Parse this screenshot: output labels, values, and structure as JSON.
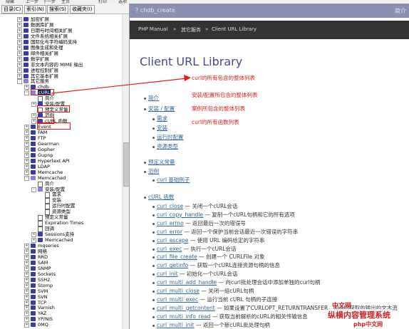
{
  "menubar": [
    "隐藏",
    "上一步",
    "下一步",
    "主页",
    "打印",
    "选项"
  ],
  "left": {
    "tabs": [
      "目录(C)",
      "索引(N)",
      "搜索(S)",
      "收藏夹(I)"
    ],
    "tree": [
      {
        "d": 1,
        "e": "+",
        "i": "book",
        "t": "加密扩展"
      },
      {
        "d": 1,
        "e": "+",
        "i": "book",
        "t": "数据库扩展"
      },
      {
        "d": 1,
        "e": "+",
        "i": "book",
        "t": "日期与时间相关扩展"
      },
      {
        "d": 1,
        "e": "+",
        "i": "book",
        "t": "文件系统相关扩展"
      },
      {
        "d": 1,
        "e": "+",
        "i": "book",
        "t": "国际化与字符编码支持"
      },
      {
        "d": 1,
        "e": "+",
        "i": "book",
        "t": "图像生成和处理"
      },
      {
        "d": 1,
        "e": "+",
        "i": "book",
        "t": "邮件相关扩展"
      },
      {
        "d": 1,
        "e": "+",
        "i": "book",
        "t": "数学扩展"
      },
      {
        "d": 1,
        "e": "+",
        "i": "book",
        "t": "非文本内容的 MIME 输出"
      },
      {
        "d": 1,
        "e": "+",
        "i": "book",
        "t": "进程控制扩展"
      },
      {
        "d": 1,
        "e": "+",
        "i": "book",
        "t": "其它基本扩展"
      },
      {
        "d": 1,
        "e": "-",
        "i": "open",
        "t": "其它服务"
      },
      {
        "d": 2,
        "e": "+",
        "i": "book",
        "t": "chdb"
      },
      {
        "d": 2,
        "e": "-",
        "i": "open",
        "t": "cURL",
        "sel": true
      },
      {
        "d": 3,
        "e": "",
        "i": "page",
        "t": "简介"
      },
      {
        "d": 3,
        "e": "+",
        "i": "book",
        "t": "安装/配置"
      },
      {
        "d": 3,
        "e": "",
        "i": "page",
        "t": "预定义常量"
      },
      {
        "d": 3,
        "e": "+",
        "i": "book",
        "t": "范例"
      },
      {
        "d": 3,
        "e": "+",
        "i": "book",
        "t": "cURL 函数"
      },
      {
        "d": 2,
        "e": "+",
        "i": "book",
        "t": "Event"
      },
      {
        "d": 2,
        "e": "+",
        "i": "book",
        "t": "FAM"
      },
      {
        "d": 2,
        "e": "+",
        "i": "book",
        "t": "FTP"
      },
      {
        "d": 2,
        "e": "+",
        "i": "book",
        "t": "Gearman"
      },
      {
        "d": 2,
        "e": "+",
        "i": "book",
        "t": "Gopher"
      },
      {
        "d": 2,
        "e": "+",
        "i": "book",
        "t": "Gupnp"
      },
      {
        "d": 2,
        "e": "+",
        "i": "book",
        "t": "Hypertext API"
      },
      {
        "d": 2,
        "e": "+",
        "i": "book",
        "t": "LDAP"
      },
      {
        "d": 2,
        "e": "+",
        "i": "book",
        "t": "Memcache"
      },
      {
        "d": 2,
        "e": "-",
        "i": "open",
        "t": "Memcached"
      },
      {
        "d": 3,
        "e": "",
        "i": "page",
        "t": "简介"
      },
      {
        "d": 3,
        "e": "-",
        "i": "open",
        "t": "安装/配置"
      },
      {
        "d": 4,
        "e": "",
        "i": "page",
        "t": "需求"
      },
      {
        "d": 4,
        "e": "",
        "i": "page",
        "t": "安装"
      },
      {
        "d": 4,
        "e": "",
        "i": "page",
        "t": "运行时配置"
      },
      {
        "d": 4,
        "e": "",
        "i": "page",
        "t": "资源类型"
      },
      {
        "d": 3,
        "e": "",
        "i": "page",
        "t": "预定义常量"
      },
      {
        "d": 3,
        "e": "",
        "i": "page",
        "t": "Expiration Times"
      },
      {
        "d": 3,
        "e": "",
        "i": "page",
        "t": "回调"
      },
      {
        "d": 3,
        "e": "+",
        "i": "book",
        "t": "Sessions支持"
      },
      {
        "d": 3,
        "e": "+",
        "i": "book",
        "t": "Memcached"
      },
      {
        "d": 2,
        "e": "+",
        "i": "book",
        "t": "mqseries"
      },
      {
        "d": 2,
        "e": "+",
        "i": "book",
        "t": "网络"
      },
      {
        "d": 2,
        "e": "+",
        "i": "book",
        "t": "RRD"
      },
      {
        "d": 2,
        "e": "+",
        "i": "book",
        "t": "SAM"
      },
      {
        "d": 2,
        "e": "+",
        "i": "book",
        "t": "SNMP"
      },
      {
        "d": 2,
        "e": "+",
        "i": "book",
        "t": "Sockets"
      },
      {
        "d": 2,
        "e": "+",
        "i": "book",
        "t": "SSH2"
      },
      {
        "d": 2,
        "e": "+",
        "i": "book",
        "t": "Stomp"
      },
      {
        "d": 2,
        "e": "+",
        "i": "book",
        "t": "SVM"
      },
      {
        "d": 2,
        "e": "+",
        "i": "book",
        "t": "SVN"
      },
      {
        "d": 2,
        "e": "+",
        "i": "book",
        "t": "TCP"
      },
      {
        "d": 2,
        "e": "+",
        "i": "book",
        "t": "Varnish"
      },
      {
        "d": 2,
        "e": "+",
        "i": "book",
        "t": "YAZ"
      },
      {
        "d": 2,
        "e": "+",
        "i": "book",
        "t": "YP/NIS"
      },
      {
        "d": 2,
        "e": "+",
        "i": "book",
        "t": "0MQ"
      }
    ]
  },
  "right": {
    "window_title": "? chdb_create",
    "window_right": "简介",
    "breadcrumb": [
      "PHP Manual",
      "其它服务",
      "Client URL Library"
    ],
    "page_title": "Client URL Library",
    "toc": {
      "intro": "简介",
      "install": "安装 / 配置",
      "install_sub": [
        "需求",
        "安装",
        "运行时配置",
        "资源类型"
      ],
      "constants": "预定义常量",
      "examples": "范例",
      "examples_sub": [
        "curl 基础例子"
      ],
      "functions": "cURL 函数"
    },
    "functions": [
      {
        "name": "curl_close",
        "desc": "— 关闭一个cURL会话"
      },
      {
        "name": "curl_copy_handle",
        "desc": "— 复制一个cURL句柄和它的所有选项"
      },
      {
        "name": "curl_errno",
        "desc": "— 返回最后一次的错误号"
      },
      {
        "name": "curl_error",
        "desc": "— 返回一个保护当前会话最近一次错误的字符串"
      },
      {
        "name": "curl_escape",
        "desc": "— 使用 URL 编码给定的字符串"
      },
      {
        "name": "curl_exec",
        "desc": "— 执行一个cURL会话"
      },
      {
        "name": "curl_file_create",
        "desc": "— 创建一个 CURLFile 对象"
      },
      {
        "name": "curl_getinfo",
        "desc": "— 获取一个cURL连接资源句柄的信息"
      },
      {
        "name": "curl_init",
        "desc": "— 初始化一个cURL会话"
      },
      {
        "name": "curl_multi_add_handle",
        "desc": "— 向curl批处理会话中添加单独的curl句柄"
      },
      {
        "name": "curl_multi_close",
        "desc": "— 关闭一组cURL句柄"
      },
      {
        "name": "curl_multi_exec",
        "desc": "— 运行当前 cURL 句柄的子连接"
      },
      {
        "name": "curl_multi_getcontent",
        "desc": "— 如果设置了CURLOPT_RETURNTRANSFER，则返回获取的输出的文本流"
      },
      {
        "name": "curl_multi_info_read",
        "desc": "— 获取当前解析的cURL的相关传输信息"
      },
      {
        "name": "curl_multi_init",
        "desc": "— 返回一个新cURL批处理句柄"
      }
    ]
  },
  "annotations": [
    "curl的所有包含的整体列表",
    "安装/配置所包含的整体列表",
    "案例所包含的整体列表",
    "curl的所有函数列表"
  ],
  "watermark": {
    "top": "中文网",
    "main": "纵横内容管理系统",
    "bottom": "php中文网"
  },
  "colors": {
    "annotation": "#e21b1b",
    "selection": "#0a246a",
    "link": "#336699",
    "title": "#4a4a8c"
  }
}
